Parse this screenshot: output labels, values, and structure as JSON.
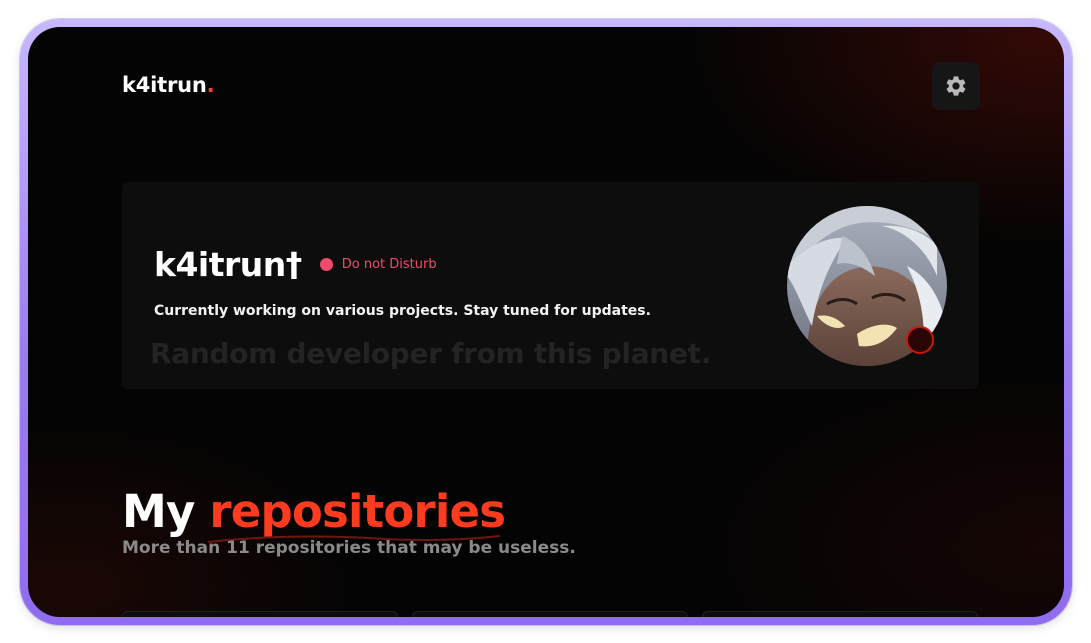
{
  "header": {
    "brand": "k4itrun",
    "brand_dot": "."
  },
  "profile": {
    "name": "k4itrun†",
    "status_label": "Do not Disturb",
    "status_color": "#f04a6b",
    "description": "Currently working on various projects. Stay tuned for updates.",
    "tagline": "Random developer from this planet."
  },
  "repositories": {
    "title_prefix": "My",
    "title_accent": "repositories",
    "subtitle": "More than 11 repositories that may be useless."
  },
  "icons": {
    "settings": "gear-icon",
    "avatar_status": "status-indicator-icon"
  },
  "colors": {
    "accent": "#ff3b1f",
    "background": "#040404",
    "frame": "#9b7cf0"
  }
}
